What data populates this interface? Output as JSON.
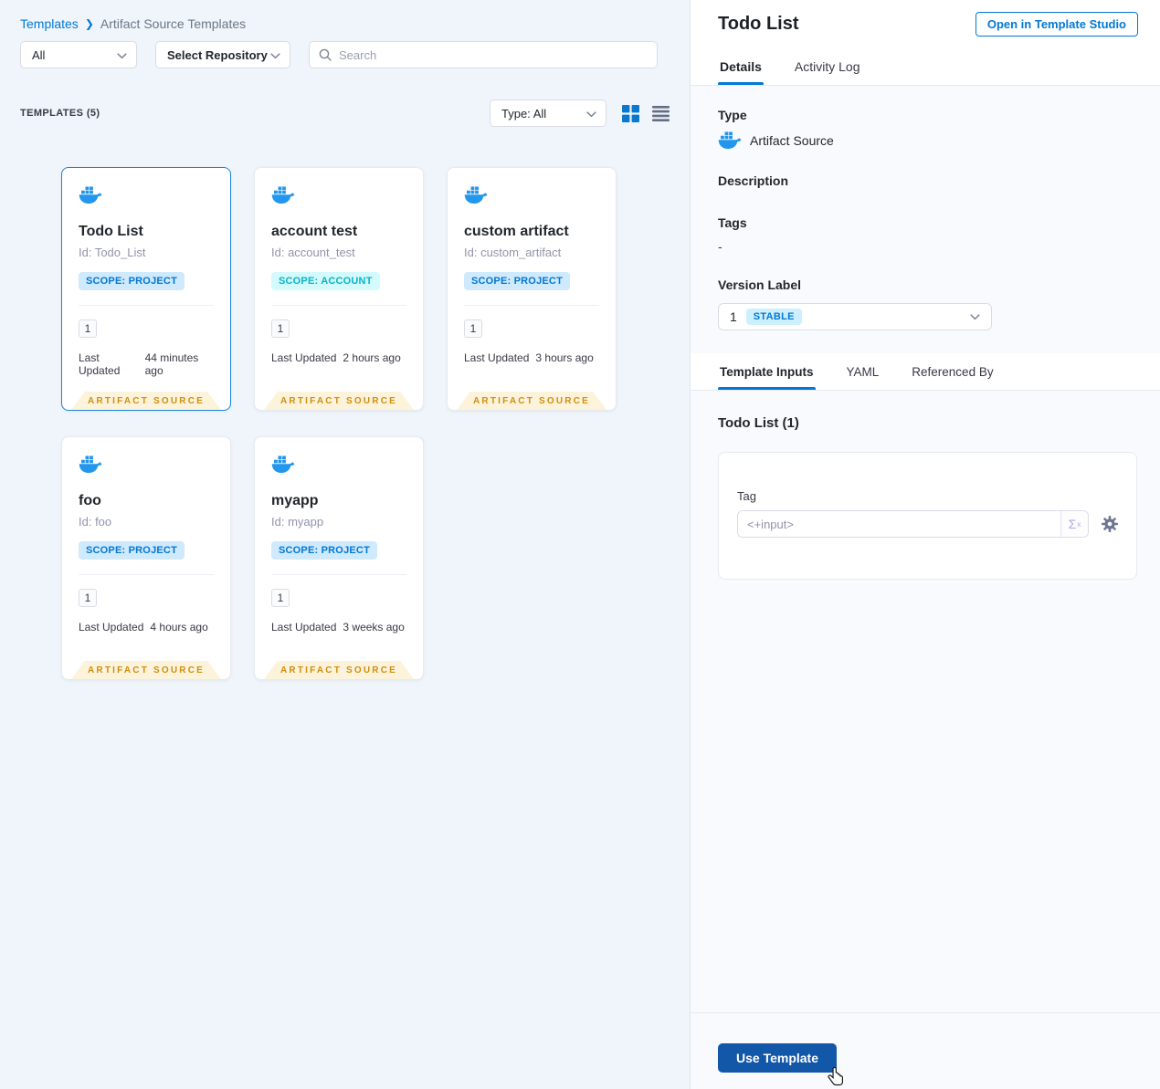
{
  "breadcrumb": {
    "root": "Templates",
    "separator": "❯",
    "current": "Artifact Source Templates"
  },
  "filters": {
    "scope_dropdown": "All",
    "repository_dropdown": "Select Repository",
    "search_placeholder": "Search"
  },
  "list_header": {
    "count_label": "TEMPLATES (5)",
    "type_dropdown": "Type: All"
  },
  "cards": [
    {
      "title": "Todo List",
      "id": "Id: Todo_List",
      "scope": "SCOPE: PROJECT",
      "scope_type": "project",
      "version": "1",
      "last_updated_label": "Last Updated",
      "last_updated": "44 minutes ago",
      "footer": "ARTIFACT SOURCE",
      "selected": true
    },
    {
      "title": "account test",
      "id": "Id: account_test",
      "scope": "SCOPE: ACCOUNT",
      "scope_type": "account",
      "version": "1",
      "last_updated_label": "Last Updated",
      "last_updated": "2 hours ago",
      "footer": "ARTIFACT SOURCE",
      "selected": false
    },
    {
      "title": "custom artifact",
      "id": "Id: custom_artifact",
      "scope": "SCOPE: PROJECT",
      "scope_type": "project",
      "version": "1",
      "last_updated_label": "Last Updated",
      "last_updated": "3 hours ago",
      "footer": "ARTIFACT SOURCE",
      "selected": false
    },
    {
      "title": "foo",
      "id": "Id: foo",
      "scope": "SCOPE: PROJECT",
      "scope_type": "project",
      "version": "1",
      "last_updated_label": "Last Updated",
      "last_updated": "4 hours ago",
      "footer": "ARTIFACT SOURCE",
      "selected": false
    },
    {
      "title": "myapp",
      "id": "Id: myapp",
      "scope": "SCOPE: PROJECT",
      "scope_type": "project",
      "version": "1",
      "last_updated_label": "Last Updated",
      "last_updated": "3 weeks ago",
      "footer": "ARTIFACT SOURCE",
      "selected": false
    }
  ],
  "detail": {
    "title": "Todo List",
    "open_button": "Open in Template Studio",
    "tabs": [
      "Details",
      "Activity Log"
    ],
    "type_label": "Type",
    "type_value": "Artifact Source",
    "description_label": "Description",
    "tags_label": "Tags",
    "tags_value": "-",
    "version_label": "Version Label",
    "version_value": "1",
    "version_badge": "STABLE",
    "sub_tabs": [
      "Template Inputs",
      "YAML",
      "Referenced By"
    ],
    "inputs_title": "Todo List (1)",
    "tag_label": "Tag",
    "tag_placeholder": "<+input>",
    "sigma": "Σ",
    "sigma_sup": "x",
    "use_template": "Use Template"
  },
  "colors": {
    "accent_blue": "#0278d5",
    "docker_blue": "#2396ed",
    "scope_project_bg": "#cfe9fd",
    "scope_account_bg": "#d3fbfe",
    "scope_account_text": "#0ab4c3",
    "ribbon_bg": "#fcf3da",
    "ribbon_text": "#d18f0f",
    "stable_badge_bg": "#cdf0fe",
    "use_template_bg": "#1257a8",
    "left_panel_bg": "#eff5fa",
    "right_panel_bg": "#f8fafd"
  }
}
